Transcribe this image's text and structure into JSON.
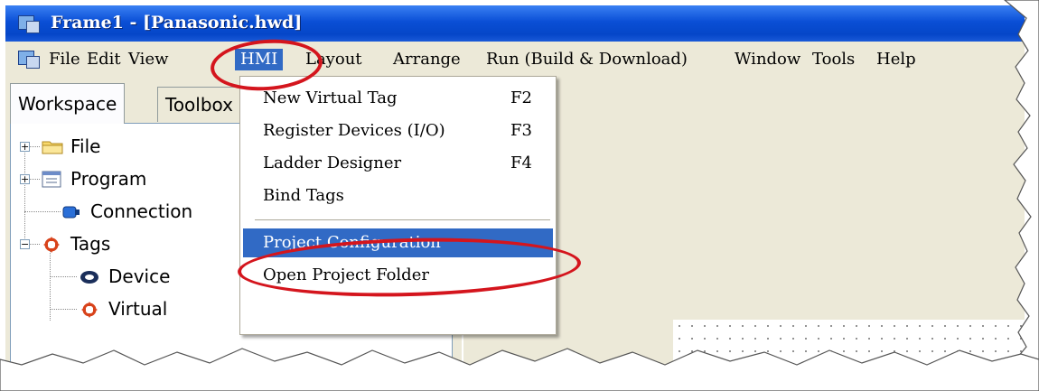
{
  "window": {
    "title": "Frame1 - [Panasonic.hwd]"
  },
  "menubar": {
    "items": [
      {
        "label": "File"
      },
      {
        "label": "Edit"
      },
      {
        "label": "View"
      },
      {
        "label": "HMI"
      },
      {
        "label": "Layout"
      },
      {
        "label": "Arrange"
      },
      {
        "label": "Run (Build & Download)"
      },
      {
        "label": "Window"
      },
      {
        "label": "Tools"
      },
      {
        "label": "Help"
      }
    ],
    "active": "HMI"
  },
  "left_pane": {
    "tabs": [
      {
        "label": "Workspace"
      },
      {
        "label": "Toolbox"
      }
    ],
    "tree": [
      {
        "label": "File",
        "icon": "folder-icon",
        "expander": "+"
      },
      {
        "label": "Program",
        "icon": "program-icon",
        "expander": "+"
      },
      {
        "label": "Connection",
        "icon": "connection-icon",
        "expander": ""
      },
      {
        "label": "Tags",
        "icon": "tags-icon",
        "expander": "−"
      },
      {
        "label": "Device",
        "icon": "device-tag-icon",
        "expander": ""
      },
      {
        "label": "Virtual",
        "icon": "virtual-tag-icon",
        "expander": ""
      }
    ]
  },
  "hmi_menu": {
    "items": [
      {
        "label": "New Virtual Tag",
        "shortcut": "F2"
      },
      {
        "label": "Register Devices (I/O)",
        "shortcut": "F3"
      },
      {
        "label": "Ladder Designer",
        "shortcut": "F4"
      },
      {
        "label": "Bind Tags",
        "shortcut": ""
      },
      {
        "label": "Project Configuration",
        "shortcut": ""
      },
      {
        "label": "Open Project Folder",
        "shortcut": ""
      }
    ],
    "highlighted": "Project Configuration"
  },
  "colors": {
    "titlebar": "#0a4fd6",
    "highlight": "#316ac5",
    "annotation": "#d4151d",
    "face": "#ece9d8"
  }
}
